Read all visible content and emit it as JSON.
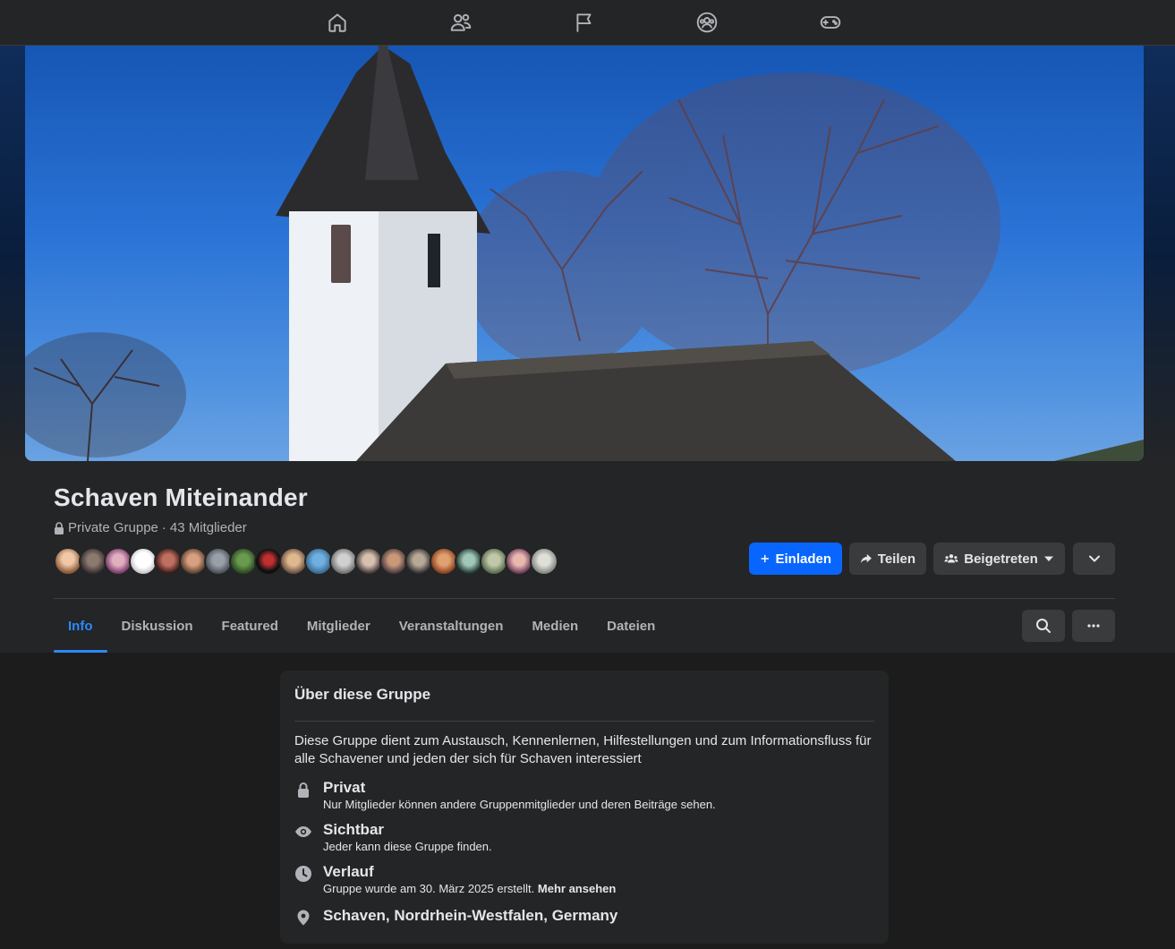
{
  "nav": {
    "icons": [
      "home-icon",
      "friends-icon",
      "pages-flag-icon",
      "groups-icon",
      "gaming-icon"
    ]
  },
  "group": {
    "name": "Schaven Miteinander",
    "privacy": "Private Gruppe",
    "separator": "·",
    "members": "43 Mitglieder"
  },
  "actions": {
    "invite": "Einladen",
    "share": "Teilen",
    "joined": "Beigetreten"
  },
  "tabs": [
    "Info",
    "Diskussion",
    "Featured",
    "Mitglieder",
    "Veranstaltungen",
    "Medien",
    "Dateien"
  ],
  "about": {
    "title": "Über diese Gruppe",
    "description": "Diese Gruppe dient zum Austausch, Kennenlernen, Hilfestellungen und zum Informationsfluss für alle Schavener und jeden der sich für Schaven interessiert",
    "private_head": "Privat",
    "private_sub": "Nur Mitglieder können andere Gruppenmitglieder und deren Beiträge sehen.",
    "visible_head": "Sichtbar",
    "visible_sub": "Jeder kann diese Gruppe finden.",
    "history_head": "Verlauf",
    "history_sub": "Gruppe wurde am 30. März 2025 erstellt.",
    "history_more": "Mehr ansehen",
    "location": "Schaven, Nordrhein-Westfalen, Germany"
  },
  "colors": {
    "accent": "#0866ff",
    "tab_active": "#2d88ff",
    "background": "#1c1c1d",
    "surface": "#242526"
  }
}
